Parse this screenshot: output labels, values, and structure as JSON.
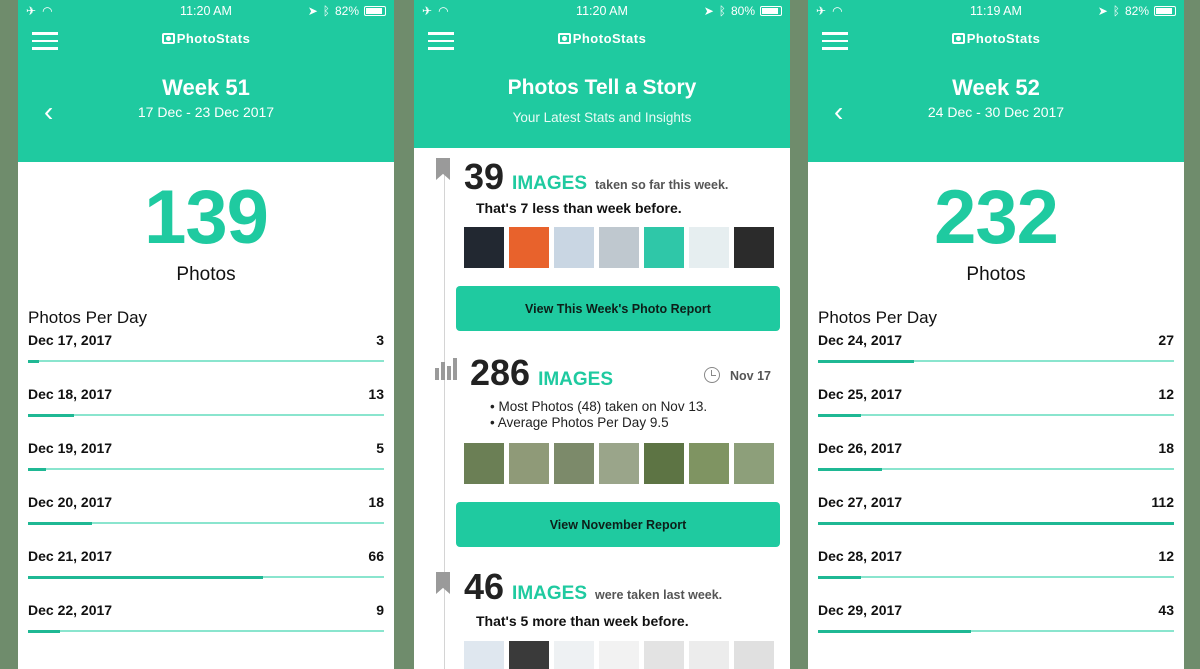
{
  "left_phone": {
    "status": {
      "time": "11:20 AM",
      "battery": "82%"
    },
    "brand": "PhotoStats",
    "week_title": "Week 51",
    "week_range": "17 Dec - 23 Dec 2017",
    "total": "139",
    "total_label": "Photos",
    "section_title": "Photos Per Day",
    "days": [
      {
        "date": "Dec 17, 2017",
        "count": "3",
        "fraction": 0.03
      },
      {
        "date": "Dec 18, 2017",
        "count": "13",
        "fraction": 0.13
      },
      {
        "date": "Dec 19, 2017",
        "count": "5",
        "fraction": 0.05
      },
      {
        "date": "Dec 20, 2017",
        "count": "18",
        "fraction": 0.18
      },
      {
        "date": "Dec 21, 2017",
        "count": "66",
        "fraction": 0.66
      },
      {
        "date": "Dec 22, 2017",
        "count": "9",
        "fraction": 0.09
      }
    ]
  },
  "middle_phone": {
    "status": {
      "time": "11:20 AM",
      "battery": "80%"
    },
    "brand": "PhotoStats",
    "title": "Photos Tell a Story",
    "subtitle": "Your Latest Stats and Insights",
    "card1": {
      "count": "39",
      "unit": "IMAGES",
      "tail": "taken so far this week.",
      "comparison": "That's 7 less than week before.",
      "button": "View This Week's Photo Report",
      "thumb_colors": [
        "#222831",
        "#e8622c",
        "#c9d6e3",
        "#bfc8cf",
        "#2fc7a8",
        "#e6eef0",
        "#2b2b2b"
      ]
    },
    "card2": {
      "count": "286",
      "unit": "IMAGES",
      "date": "Nov 17",
      "bullets": [
        "• Most Photos (48) taken on Nov 13.",
        "• Average Photos Per Day 9.5"
      ],
      "button": "View November Report",
      "thumb_colors": [
        "#6b7f55",
        "#8f9a78",
        "#7c8a6a",
        "#9aa58a",
        "#5d7444",
        "#7f9462",
        "#8d9f7a"
      ]
    },
    "card3": {
      "count": "46",
      "unit": "IMAGES",
      "tail": "were taken last week.",
      "comparison": "That's 5 more than week before.",
      "thumb_colors": [
        "#dfe7ef",
        "#3a3a3a",
        "#eef1f3",
        "#f2f2f2",
        "#e3e3e3",
        "#ececec",
        "#e0e0e0"
      ]
    }
  },
  "right_phone": {
    "status": {
      "time": "11:19 AM",
      "battery": "82%"
    },
    "brand": "PhotoStats",
    "week_title": "Week 52",
    "week_range": "24 Dec - 30 Dec 2017",
    "total": "232",
    "total_label": "Photos",
    "section_title": "Photos Per Day",
    "days": [
      {
        "date": "Dec 24, 2017",
        "count": "27",
        "fraction": 0.27
      },
      {
        "date": "Dec 25, 2017",
        "count": "12",
        "fraction": 0.12
      },
      {
        "date": "Dec 26, 2017",
        "count": "18",
        "fraction": 0.18
      },
      {
        "date": "Dec 27, 2017",
        "count": "112",
        "fraction": 1.0
      },
      {
        "date": "Dec 28, 2017",
        "count": "12",
        "fraction": 0.12
      },
      {
        "date": "Dec 29, 2017",
        "count": "43",
        "fraction": 0.43
      }
    ]
  },
  "colors": {
    "accent": "#1fcaa0",
    "bar_fill": "#1fb894",
    "bar_track": "#8ae5ce",
    "backdrop": "#6f8c6c"
  }
}
